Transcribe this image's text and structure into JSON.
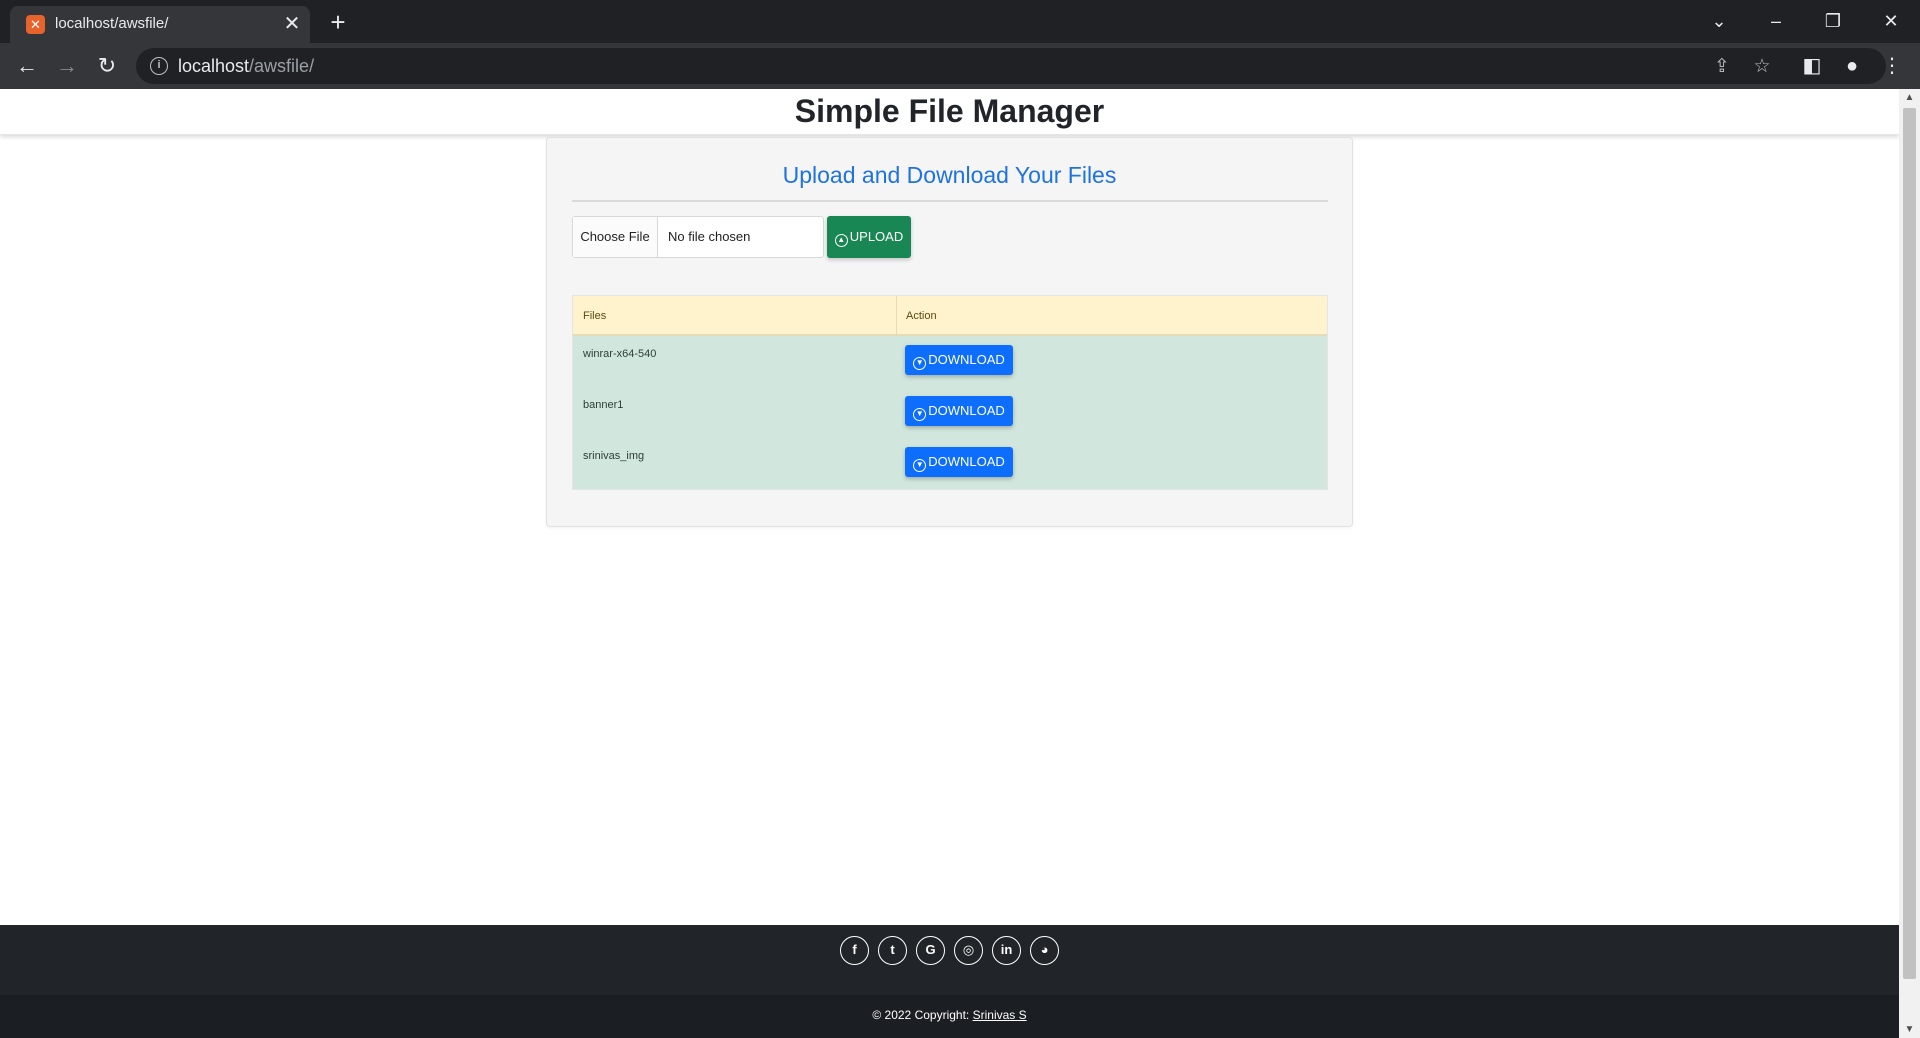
{
  "browser": {
    "tab_title": "localhost/awsfile/",
    "tab_favicon": "xampp-icon",
    "url_host": "localhost",
    "url_path": "/awsfile/"
  },
  "header": {
    "title": "Simple File Manager"
  },
  "card": {
    "heading": "Upload and Download Your Files",
    "choose_file_label": "Choose File",
    "file_status": "No file chosen",
    "upload_label": "UPLOAD"
  },
  "table": {
    "columns": [
      "Files",
      "Action"
    ],
    "rows": [
      {
        "name": "winrar-x64-540",
        "action": "DOWNLOAD"
      },
      {
        "name": "banner1",
        "action": "DOWNLOAD"
      },
      {
        "name": "srinivas_img",
        "action": "DOWNLOAD"
      }
    ]
  },
  "footer": {
    "social": [
      {
        "name": "facebook-icon",
        "glyph": "f"
      },
      {
        "name": "twitter-icon",
        "glyph": "t"
      },
      {
        "name": "google-icon",
        "glyph": "G"
      },
      {
        "name": "instagram-icon",
        "glyph": "◎"
      },
      {
        "name": "linkedin-icon",
        "glyph": "in"
      },
      {
        "name": "github-icon",
        "glyph": "◕"
      }
    ],
    "copyright_prefix": "© 2022 Copyright:",
    "copyright_link": "Srinivas S"
  },
  "colors": {
    "upload_button": "#198754",
    "download_button": "#0d6efd",
    "heading_blue": "#1e73e0",
    "table_header_bg": "#fff3cd",
    "table_body_bg": "#d1e7dd",
    "footer_bg": "#212529"
  }
}
